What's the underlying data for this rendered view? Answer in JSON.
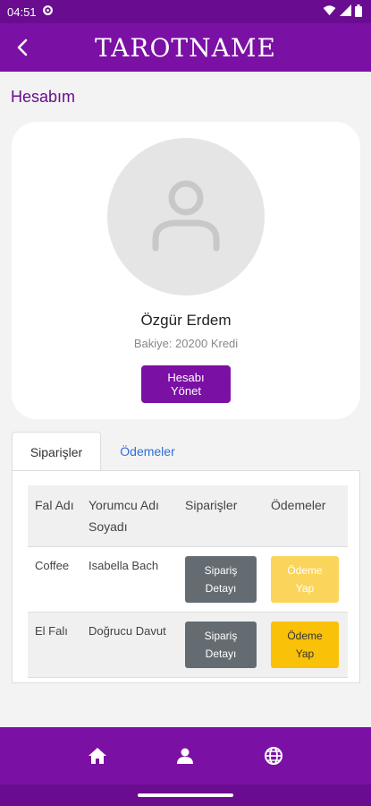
{
  "statusbar": {
    "time": "04:51"
  },
  "appbar": {
    "title": "TAROTNAME"
  },
  "section_title": "Hesabım",
  "profile": {
    "name": "Özgür Erdem",
    "balance": "Bakiye: 20200 Kredi",
    "manage_label": "Hesabı Yönet"
  },
  "tabs": [
    {
      "label": "Siparişler",
      "active": true
    },
    {
      "label": "Ödemeler",
      "active": false
    }
  ],
  "table": {
    "headers": [
      "Fal Adı",
      "Yorumcu Adı Soyadı",
      "Siparişler",
      "Ödemeler"
    ],
    "rows": [
      {
        "fal": "Coffee",
        "yorumcu": "Isabella Bach",
        "detail_label": "Sipariş Detayı",
        "pay_label": "Ödeme Yap"
      },
      {
        "fal": "El Falı",
        "yorumcu": "Doğrucu Davut",
        "detail_label": "Sipariş Detayı",
        "pay_label": "Ödeme Yap"
      }
    ]
  },
  "icons": {
    "back": "arrow-left-icon",
    "settings": "gear-icon",
    "wifi": "wifi-icon",
    "signal": "signal-icon",
    "battery": "battery-icon",
    "home": "home-icon",
    "person": "person-icon",
    "globe": "globe-icon"
  },
  "colors": {
    "primary": "#7b10a4",
    "status_bar": "#6a0c8f",
    "detail_button": "#646c72",
    "pay_button_light": "#fbd55b",
    "pay_button_strong": "#f9c107",
    "tab_link": "#2f6fd6"
  }
}
